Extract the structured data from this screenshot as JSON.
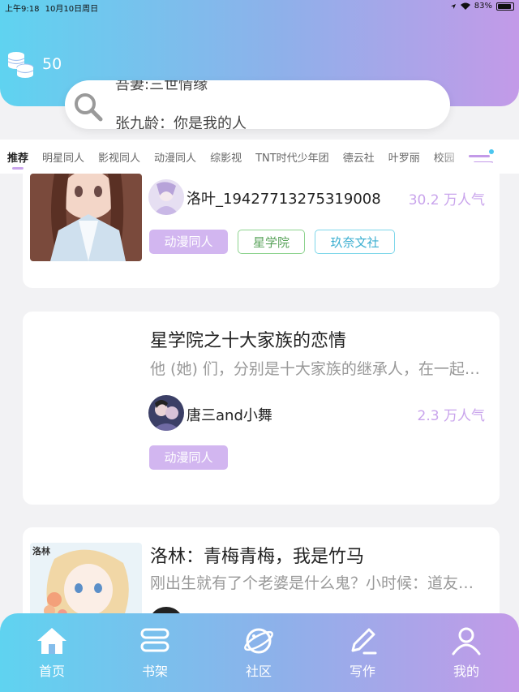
{
  "status_bar": {
    "time": "上午9:18",
    "date": "10月10日周日",
    "battery": "83%"
  },
  "header": {
    "coin_count": "50"
  },
  "search": {
    "line1": "吾妻:三世情缘",
    "line2": "张九龄：你是我的人"
  },
  "categories": [
    "推荐",
    "明星同人",
    "影视同人",
    "动漫同人",
    "综影视",
    "TNT时代少年团",
    "德云社",
    "叶罗丽",
    "校园"
  ],
  "books": [
    {
      "author": "洛叶_19427713275319008",
      "popularity": "30.2 万人气",
      "tags": [
        "动漫同人",
        "星学院",
        "玖奈文社"
      ]
    },
    {
      "title": "星学院之十大家族的恋情",
      "description": "他 (她) 们，分别是十大家族的继承人，在一起经历了许多事情",
      "author": "唐三and小舞",
      "popularity": "2.3 万人气",
      "tags": [
        "动漫同人"
      ]
    },
    {
      "title": "洛林：青梅青梅，我是竹马",
      "description": "刚出生就有了个老婆是什么鬼？小时候：道友你好",
      "cover_text": "洛林"
    }
  ],
  "tabbar": {
    "home": "首页",
    "shelf": "书架",
    "community": "社区",
    "write": "写作",
    "mine": "我的"
  },
  "colors": {
    "accent_purple": "#c9a4ec",
    "gradient_start": "#5fd3f0",
    "gradient_end": "#c39ae8"
  }
}
